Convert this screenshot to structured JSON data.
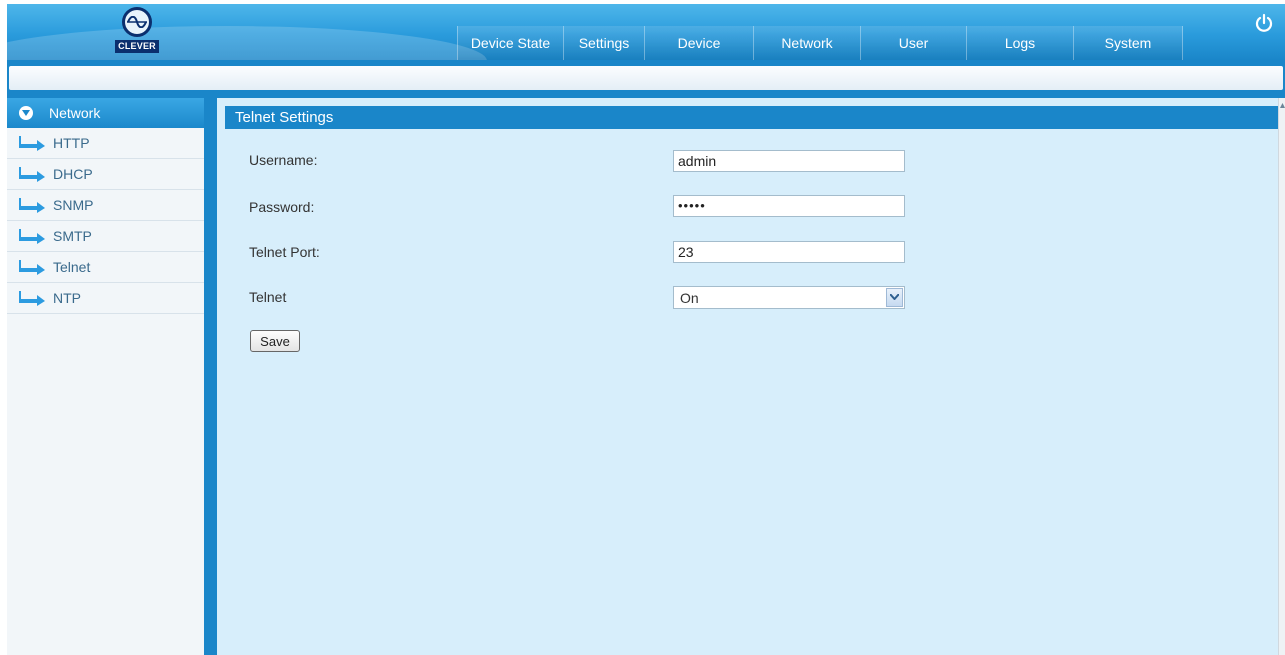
{
  "header": {
    "logo_text": "CLEVER",
    "tabs": [
      {
        "label": "Device State"
      },
      {
        "label": "Settings"
      },
      {
        "label": "Device"
      },
      {
        "label": "Network"
      },
      {
        "label": "User"
      },
      {
        "label": "Logs"
      },
      {
        "label": "System"
      }
    ],
    "power_icon": "power-icon"
  },
  "sidebar": {
    "section_label": "Network",
    "items": [
      {
        "label": "HTTP"
      },
      {
        "label": "DHCP"
      },
      {
        "label": "SNMP"
      },
      {
        "label": "SMTP"
      },
      {
        "label": "Telnet"
      },
      {
        "label": "NTP"
      }
    ]
  },
  "main": {
    "panel_title": "Telnet Settings",
    "username": {
      "label": "Username:",
      "value": "admin"
    },
    "password": {
      "label": "Password:",
      "value": "•••••"
    },
    "port": {
      "label": "Telnet Port:",
      "value": "23"
    },
    "telnet": {
      "label": "Telnet",
      "value": "On"
    },
    "save_label": "Save"
  },
  "colors": {
    "header_blue": "#2a9bdc",
    "bar_blue": "#1a86c9",
    "panel_bg": "#d7eefb"
  }
}
